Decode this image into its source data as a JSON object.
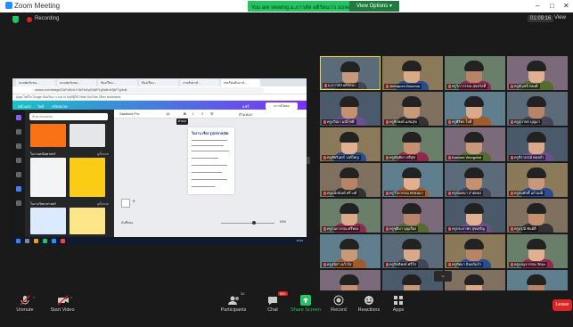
{
  "window": {
    "title": "Zoom Meeting",
    "minimize": "–",
    "maximize": "□",
    "close": "✕"
  },
  "banner": {
    "text": "You are viewing ม.ภาวลัส อดิรัตนา's screen",
    "view_options": "View Options ▾"
  },
  "topbar": {
    "recording": "Recording",
    "timer": "01:09:16",
    "view": "View"
  },
  "browser": {
    "tabs": [
      "แบบฟอร์มขอ...",
      "แบบฟอร์มขอ...",
      "ห้องเรียน...",
      "ห้องเรียน...",
      "งานสัปดาห์...",
      "บทเรียนสัปดาห์..."
    ],
    "url": "canva.com/design/DAFu8b4cYJA/Hv0qZrfq8P1yjWaKsHjkFTg/edit",
    "bookmarks": "Apps  ไฟล์ใน Google  ห้องเรียน  ระบบงาน  บัญชีผู้ใช้  Gmail  YouTube  Other bookmarks"
  },
  "canva": {
    "home": "หน้าแรก",
    "file": "ไฟล์",
    "resize": "ปรับขนาด",
    "share_label": "แชร์",
    "share_button": "ดาวน์โหลด",
    "search_placeholder": "ค้นหาเทมเพลต",
    "section1": "ใบงานคณิตศาสตร์",
    "section2": "ใบงานวิทยาศาสตร์",
    "see_all": "ดูทั้งหมด",
    "font": "Sarabun Pro",
    "font_size": "16",
    "position": "ตำแหน่ง",
    "tooltip": "ตัวหนา",
    "page_title": "ใบงาน เรื่อง รูปเรขาคณิต",
    "notes": "บันทึกย่อ",
    "zoom": "50%"
  },
  "taskbar": {
    "clock": "10:52"
  },
  "participants": [
    "ม.ภาวลัส อดิรัตนา",
    "Jeeraporn Boonma",
    "ครูวิภาวรรณ สุขสวัสดิ์",
    "ครูอัญชลี ทองดี",
    "ครูปวีณา มณีโชติ",
    "ครูธีรพงษ์ แสนสุข",
    "ครูศิริพร ใจดี",
    "ครูสุภาพร บุญมา",
    "ครูพัชรินทร์ วงศ์ใหญ่",
    "ครูณัฐธิดา ศรีสุข",
    "Kasinee Wongchai",
    "ครูจิราภรณ์ ทองคำ",
    "ครูมนัสนันท์ ศรีวงศ์",
    "ครูวิไลวรรณ พรหมมา",
    "ครูนันทนา สายทอง",
    "ครูสมศักดิ์ แก้วมณี",
    "ครูกนกวรรณ ศรีทอง",
    "ครูชุติมา บุญเรือง",
    "ครูประภาพร สุขเจริญ",
    "ครูอรุณี พันธ์ดี",
    "ครูสุนิสา แก้วใส",
    "ครูกิตติพงษ์ ศรีใส",
    "ครูปัทมา อินทร์แก้ว",
    "ครูเบญจวรรณ รัตนะ",
    "ครูธนพร ชัยมงคล",
    "ครูวัชรี นาคสุข",
    "ครูศุภชัย มั่นคง",
    "ครูรัชนี คงทอง"
  ],
  "controls": [
    {
      "label": "Unmute",
      "icon": "mic-muted-icon"
    },
    {
      "label": "Start Video",
      "icon": "video-off-icon"
    },
    {
      "label": "Participants",
      "icon": "participants-icon",
      "count": "32"
    },
    {
      "label": "Chat",
      "icon": "chat-icon",
      "count": "99+"
    },
    {
      "label": "Share Screen",
      "icon": "share-screen-icon"
    },
    {
      "label": "Record",
      "icon": "record-icon"
    },
    {
      "label": "Reactions",
      "icon": "reactions-icon"
    },
    {
      "label": "Apps",
      "icon": "apps-icon"
    }
  ],
  "leave": "Leave",
  "colors": {
    "accent_green": "#22c55e",
    "leave_red": "#e02424",
    "speaker_yellow": "#f5d90a",
    "canva_gradient": [
      "#17c3c9",
      "#7b2ff7"
    ]
  }
}
